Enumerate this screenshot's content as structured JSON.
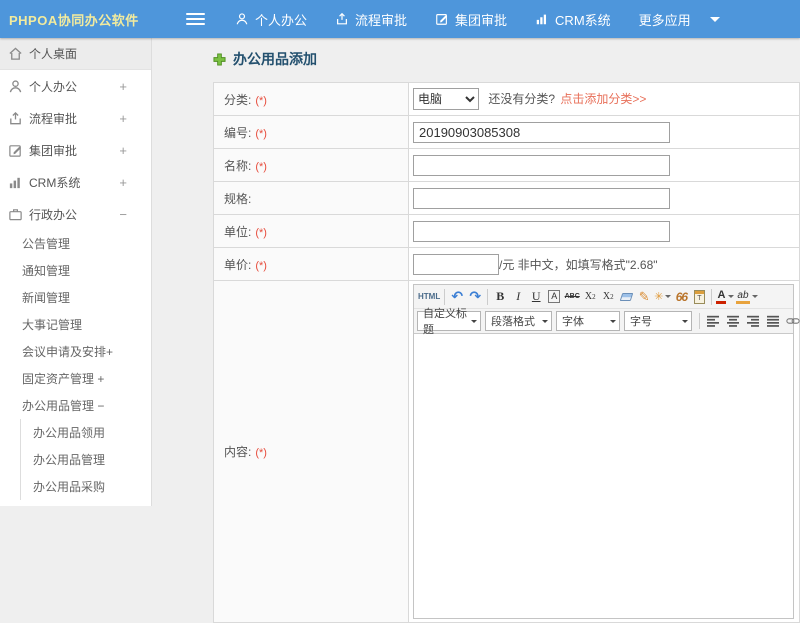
{
  "topbar": {
    "brand": "PHPOA协同办公软件",
    "nav": [
      {
        "label": "个人办公",
        "icon": "user-icon"
      },
      {
        "label": "流程审批",
        "icon": "workflow-icon"
      },
      {
        "label": "集团审批",
        "icon": "approval-edit-icon"
      },
      {
        "label": "CRM系统",
        "icon": "bar-chart-icon"
      },
      {
        "label": "更多应用",
        "icon": "caret-down-icon"
      }
    ]
  },
  "sidebar": {
    "items": [
      {
        "label": "个人桌面",
        "icon": "home-icon",
        "expand": ""
      },
      {
        "label": "个人办公",
        "icon": "user-icon",
        "expand": "+"
      },
      {
        "label": "流程审批",
        "icon": "workflow-icon",
        "expand": "+"
      },
      {
        "label": "集团审批",
        "icon": "approval-edit-icon",
        "expand": "+"
      },
      {
        "label": "CRM系统",
        "icon": "bar-chart-icon",
        "expand": "+"
      },
      {
        "label": "行政办公",
        "icon": "briefcase-icon",
        "expand": "−"
      }
    ],
    "sub_items": [
      {
        "label": "公告管理"
      },
      {
        "label": "通知管理"
      },
      {
        "label": "新闻管理"
      },
      {
        "label": "大事记管理"
      },
      {
        "label": "会议申请及安排+"
      },
      {
        "label": "固定资产管理 +"
      },
      {
        "label": "办公用品管理 −"
      }
    ],
    "third_items": [
      {
        "label": "办公用品领用"
      },
      {
        "label": "办公用品管理"
      },
      {
        "label": "办公用品采购"
      }
    ]
  },
  "main": {
    "title": "办公用品添加",
    "form": {
      "category": {
        "label": "分类:",
        "required": "(*)",
        "selected": "电脑",
        "hint": "还没有分类?",
        "link": "点击添加分类>>"
      },
      "code": {
        "label": "编号:",
        "required": "(*)",
        "value": "20190903085308"
      },
      "name": {
        "label": "名称:",
        "required": "(*)"
      },
      "spec": {
        "label": "规格:"
      },
      "unit": {
        "label": "单位:",
        "required": "(*)"
      },
      "price": {
        "label": "单价:",
        "required": "(*)",
        "hint": "/元 非中文，如填写格式\"2.68\""
      },
      "content": {
        "label": "内容:",
        "required": "(*)"
      }
    },
    "editor": {
      "html_button": "HTML",
      "buttons": {
        "undo": "↶",
        "redo": "↷",
        "bold": "B",
        "italic": "I",
        "underline": "U",
        "autotypeset": "A",
        "strike": "ABC",
        "sup_base": "X",
        "sup_exp": "2",
        "sub_base": "X",
        "sub_exp": "2",
        "brush": "✎",
        "painter": "✳",
        "quote": "66",
        "paste": "T",
        "fontcolor": "A",
        "highlight": "ab"
      },
      "selects": [
        {
          "label": "自定义标题"
        },
        {
          "label": "段落格式"
        },
        {
          "label": "字体"
        },
        {
          "label": "字号"
        }
      ]
    }
  },
  "colors": {
    "topbar_blue": "#4e96db",
    "brand_yellow": "#f2eb9e",
    "title_navy": "#23506e",
    "accent_green": "#6fb33f",
    "required_red": "#e74c3c",
    "link_red": "#e8705a"
  }
}
